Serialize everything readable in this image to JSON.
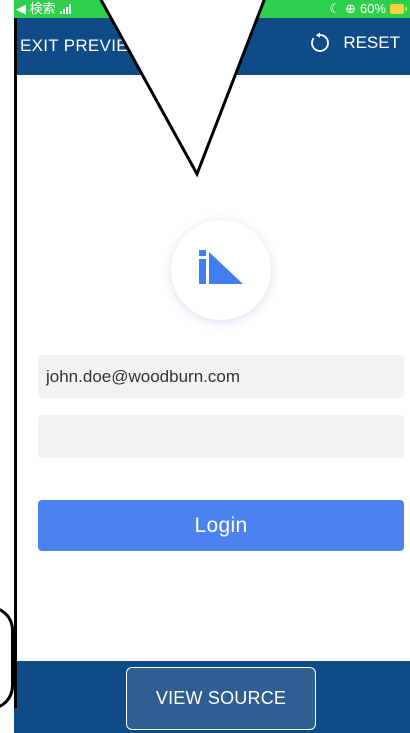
{
  "status_bar": {
    "back_label": "◀ 検索",
    "moon_glyph": "☾",
    "lock_glyph": "⊕",
    "battery_percent": "60%",
    "signal_bars": 4,
    "background_color": "#2fcf4e",
    "battery_color": "#f5d33b"
  },
  "app_bar": {
    "exit_label": "EXIT PREVIEW",
    "reset_label": "RESET",
    "reset_icon": "refresh-icon",
    "background_color": "#0f4b87"
  },
  "logo": {
    "name": "app-logo",
    "accent_color": "#3f7ef0"
  },
  "form": {
    "email_value": "john.doe@woodburn.com",
    "email_placeholder": "",
    "password_value": "",
    "password_placeholder": "",
    "login_label": "Login",
    "login_color": "#4b82f0"
  },
  "bottom_bar": {
    "view_source_label": "VIEW SOURCE",
    "background_color": "#0f4b87"
  }
}
